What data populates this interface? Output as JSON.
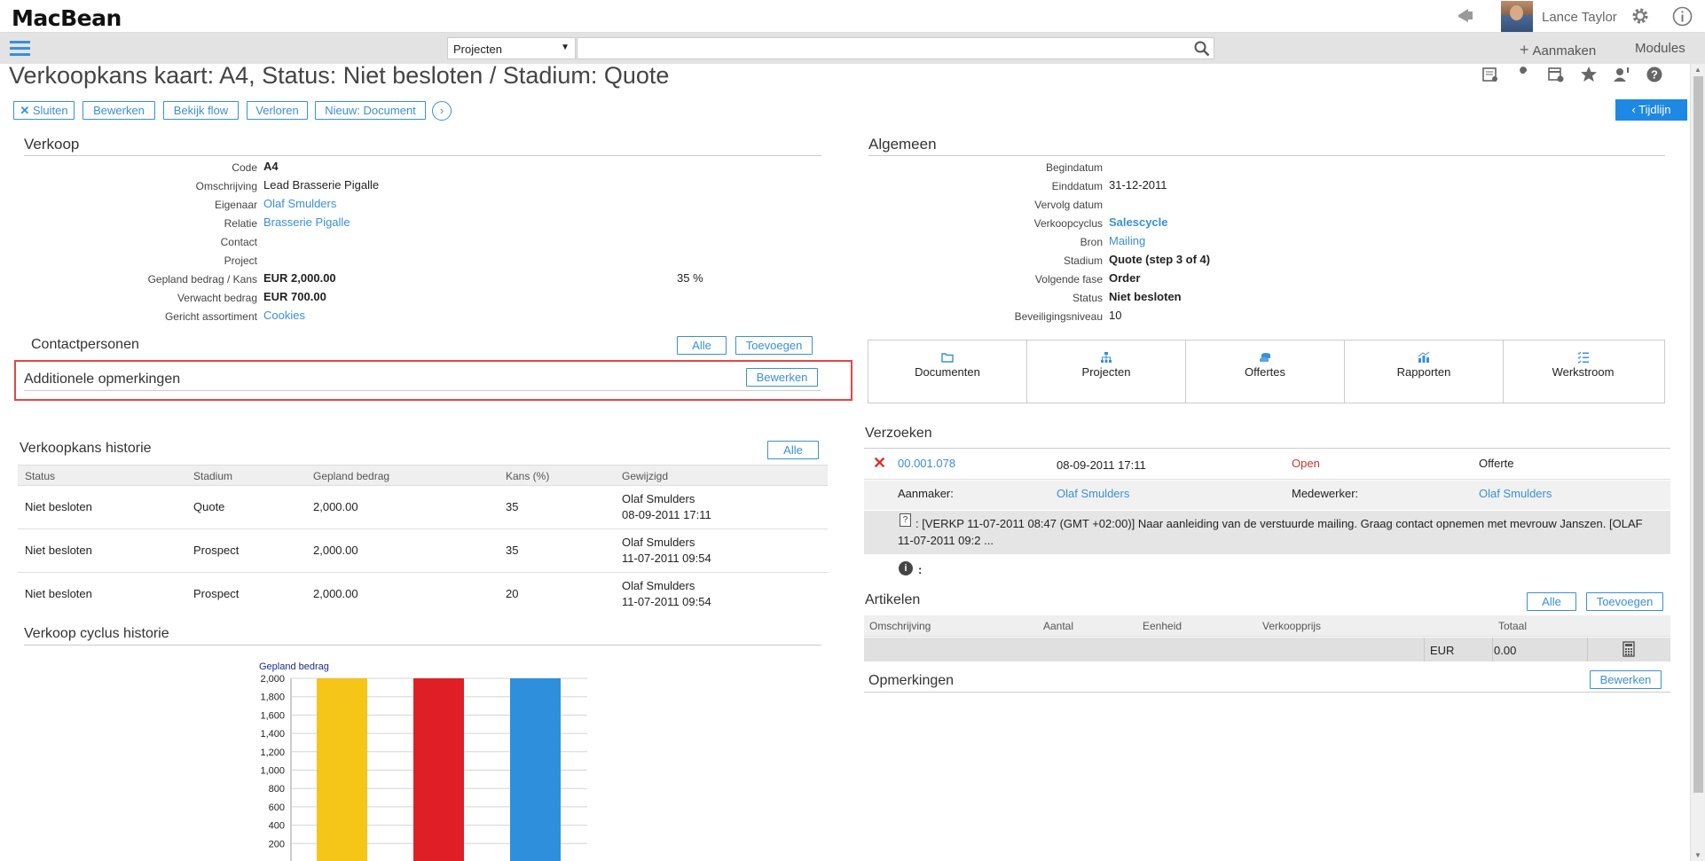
{
  "app": {
    "logo": "MacBean",
    "user_name": "Lance Taylor"
  },
  "nav": {
    "search_scope": "Projecten",
    "search_value": "",
    "create_label": "Aanmaken",
    "modules_label": "Modules"
  },
  "page": {
    "title": "Verkoopkans kaart: A4, Status: Niet besloten / Stadium: Quote",
    "actions": [
      "Sluiten",
      "Bewerken",
      "Bekijk flow",
      "Verloren",
      "Nieuw: Document"
    ],
    "timeline_label": "Tijdlijn"
  },
  "verkoop": {
    "title": "Verkoop",
    "fields": [
      {
        "label": "Code",
        "value": "A4"
      },
      {
        "label": "Omschrijving",
        "value": "Lead Brasserie Pigalle"
      },
      {
        "label": "Eigenaar",
        "value": "Olaf Smulders"
      },
      {
        "label": "Relatie",
        "value": "Brasserie Pigalle"
      },
      {
        "label": "Contact",
        "value": ""
      },
      {
        "label": "Project",
        "value": ""
      },
      {
        "label": "Gepland bedrag / Kans",
        "value": "EUR 2,000.00",
        "extra": "35 %"
      },
      {
        "label": "Verwacht bedrag",
        "value": "EUR 700.00"
      },
      {
        "label": "Gericht assortiment",
        "value": "Cookies"
      }
    ]
  },
  "contactpersonen": {
    "title": "Contactpersonen",
    "all_label": "Alle",
    "add_label": "Toevoegen"
  },
  "opmerkingen_add": {
    "title": "Additionele opmerkingen",
    "edit_label": "Bewerken"
  },
  "historie": {
    "title": "Verkoopkans historie",
    "all_label": "Alle",
    "columns": [
      "Status",
      "Stadium",
      "Gepland bedrag",
      "Kans (%)",
      "Gewijzigd"
    ],
    "rows": [
      {
        "status": "Niet besloten",
        "stadium": "Quote",
        "bedrag": "2,000.00",
        "kans": "35",
        "user": "Olaf Smulders",
        "date": "08-09-2011 17:11"
      },
      {
        "status": "Niet besloten",
        "stadium": "Prospect",
        "bedrag": "2,000.00",
        "kans": "35",
        "user": "Olaf Smulders",
        "date": "11-07-2011 09:54"
      },
      {
        "status": "Niet besloten",
        "stadium": "Prospect",
        "bedrag": "2,000.00",
        "kans": "20",
        "user": "Olaf Smulders",
        "date": "11-07-2011 09:54"
      }
    ]
  },
  "cyclus": {
    "title": "Verkoop cyclus historie"
  },
  "chart_data": {
    "type": "bar",
    "title": "Gepland bedrag",
    "categories": [
      "",
      "",
      ""
    ],
    "values": [
      2000,
      2000,
      2000
    ],
    "colors": [
      "#f5c518",
      "#e01e26",
      "#2e8fdc"
    ],
    "yticks": [
      200,
      400,
      600,
      800,
      1000,
      1200,
      1400,
      1600,
      1800,
      2000
    ],
    "ytick_labels": [
      "200",
      "400",
      "600",
      "800",
      "1,000",
      "1,200",
      "1,400",
      "1,600",
      "1,800",
      "2,000"
    ],
    "ylim": [
      0,
      2000
    ],
    "grid": true
  },
  "algemeen": {
    "title": "Algemeen",
    "fields": [
      {
        "label": "Begindatum",
        "value": ""
      },
      {
        "label": "Einddatum",
        "value": "31-12-2011"
      },
      {
        "label": "Vervolg datum",
        "value": ""
      },
      {
        "label": "Verkoopcyclus",
        "value": "Salescycle"
      },
      {
        "label": "Bron",
        "value": "Mailing"
      },
      {
        "label": "Stadium",
        "value": "Quote (step 3 of 4)"
      },
      {
        "label": "Volgende fase",
        "value": "Order"
      },
      {
        "label": "Status",
        "value": "Niet besloten"
      },
      {
        "label": "Beveiligingsniveau",
        "value": "10"
      }
    ]
  },
  "tiles": [
    "Documenten",
    "Projecten",
    "Offertes",
    "Rapporten",
    "Werkstroom"
  ],
  "verzoeken": {
    "title": "Verzoeken",
    "number": "00.001.078",
    "date": "08-09-2011 17:11",
    "status": "Open",
    "type": "Offerte",
    "creator_label": "Aanmaker:",
    "creator": "Olaf Smulders",
    "worker_label": "Medewerker:",
    "worker": "Olaf Smulders",
    "note_line1": ": [VERKP 11-07-2011 08:47 (GMT +02:00)] Naar aanleiding van de verstuurde mailing. Graag contact opnemen met mevrouw Janszen. [OLAF",
    "note_line2": "11-07-2011 09:2 ...",
    "info_text": ":"
  },
  "artikelen": {
    "title": "Artikelen",
    "all_label": "Alle",
    "add_label": "Toevoegen",
    "columns": [
      "Omschrijving",
      "Aantal",
      "Eenheid",
      "Verkoopprijs",
      "Totaal"
    ],
    "currency": "EUR",
    "total": "0.00"
  },
  "opmerkingen": {
    "title": "Opmerkingen",
    "edit_label": "Bewerken"
  }
}
